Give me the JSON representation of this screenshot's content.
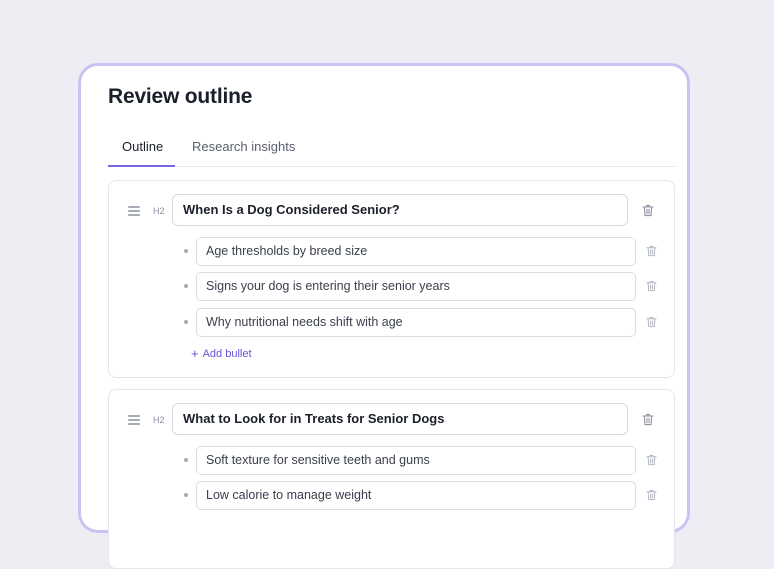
{
  "modal": {
    "title": "Review outline"
  },
  "tabs": [
    {
      "label": "Outline",
      "active": true
    },
    {
      "label": "Research insights",
      "active": false
    }
  ],
  "sections": [
    {
      "level": "H2",
      "heading": "When Is a Dog Considered Senior?",
      "bullets": [
        "Age thresholds by breed size",
        "Signs your dog is entering their senior years",
        "Why nutritional needs shift with age"
      ],
      "add_bullet_label": "Add bullet"
    },
    {
      "level": "H2",
      "heading": "What to Look for in Treats for Senior Dogs",
      "bullets": [
        "Soft texture for sensitive teeth and gums",
        "Low calorie to manage weight"
      ]
    }
  ],
  "colors": {
    "accent": "#7a66e0",
    "modal_border": "#c9c2f3",
    "background": "#efecf4"
  },
  "icons": {
    "drag": "drag-handle-icon",
    "delete": "trash-icon",
    "add": "plus-icon"
  }
}
